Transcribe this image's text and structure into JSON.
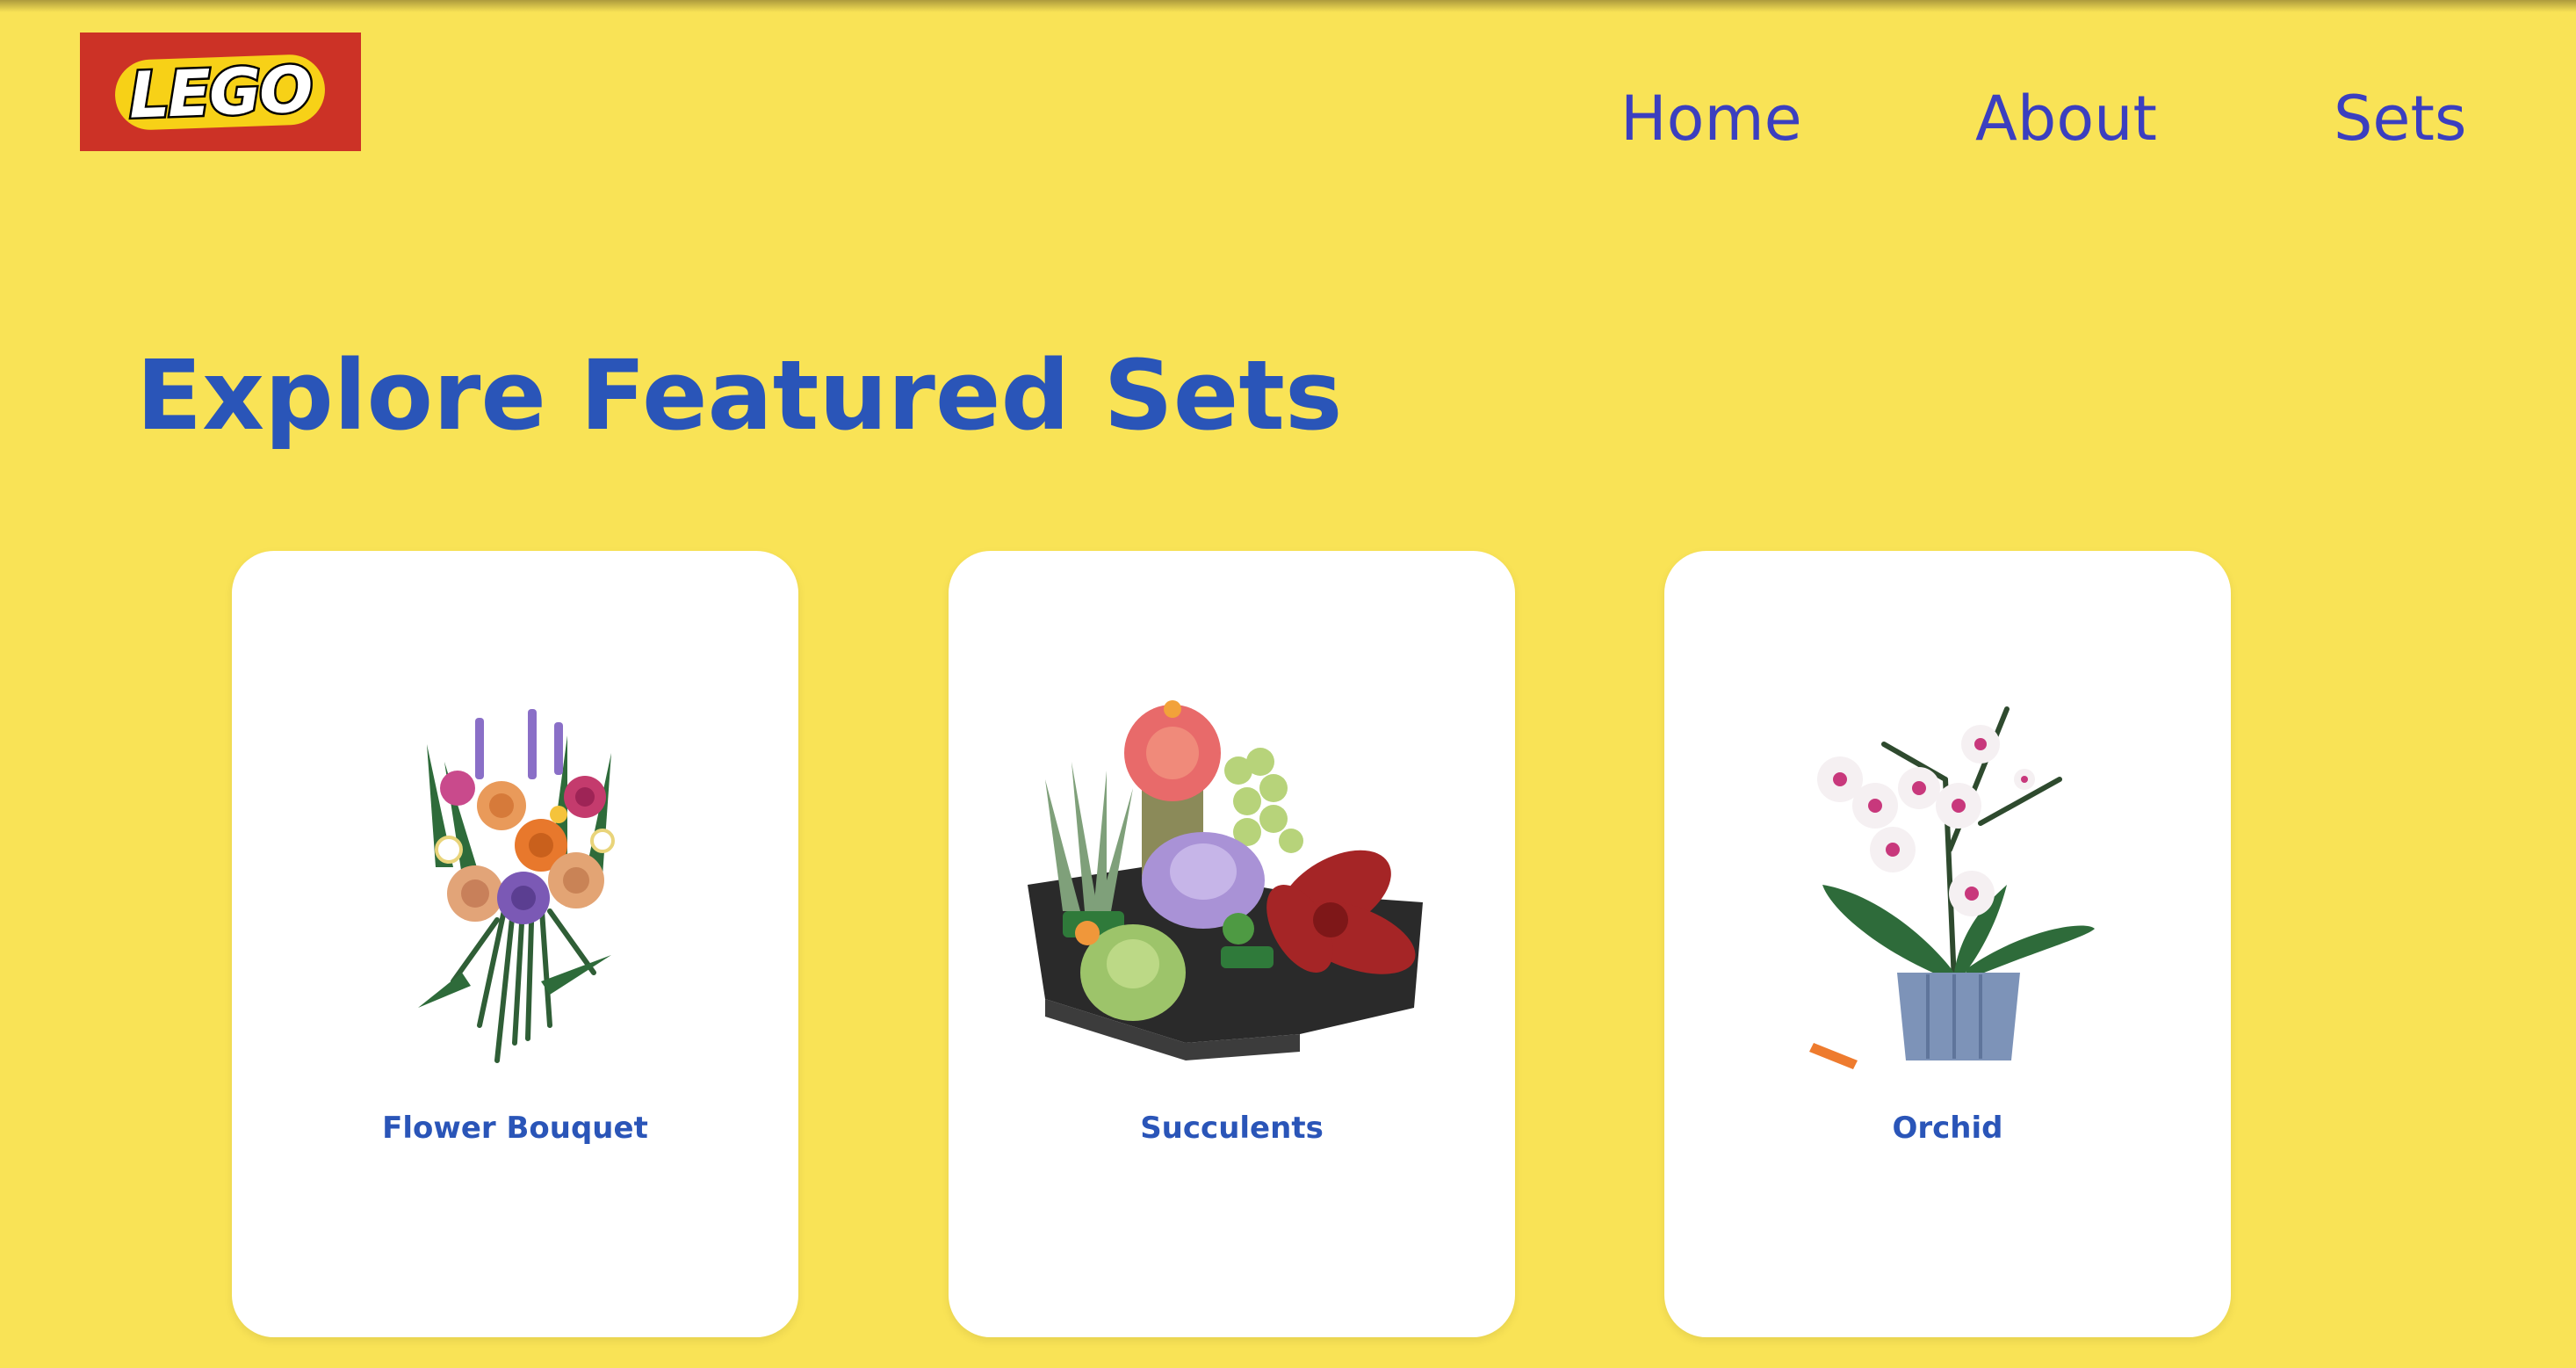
{
  "logo": {
    "text": "LEGO",
    "colors": {
      "background": "#CC3226",
      "plate": "#F7D117"
    }
  },
  "nav": {
    "items": [
      {
        "label": "Home"
      },
      {
        "label": "About"
      },
      {
        "label": "Sets"
      }
    ]
  },
  "main": {
    "title": "Explore Featured Sets",
    "cards": [
      {
        "title": "Flower Bouquet",
        "image": "flower-bouquet-image"
      },
      {
        "title": "Succulents",
        "image": "succulents-image"
      },
      {
        "title": "Orchid",
        "image": "orchid-image"
      }
    ]
  },
  "colors": {
    "background": "#F9E356",
    "nav_link": "#3B3FBF",
    "heading": "#2A55B8",
    "card": "#FFFFFF"
  }
}
